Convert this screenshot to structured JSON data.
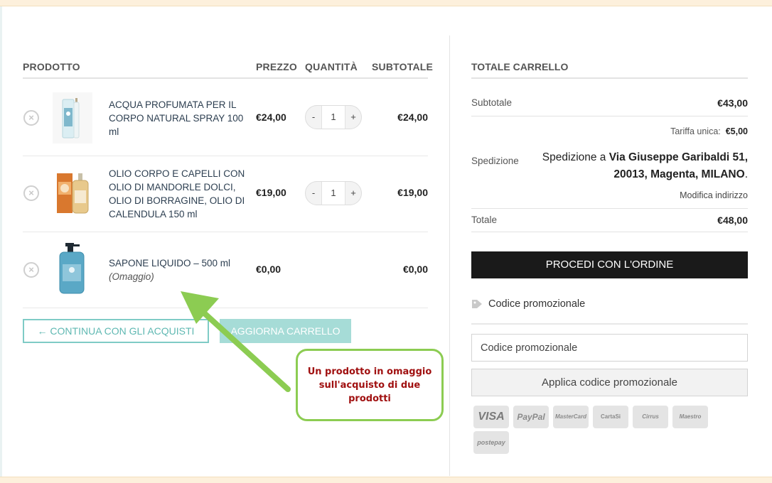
{
  "cart": {
    "headers": {
      "product": "PRODOTTO",
      "price": "PREZZO",
      "quantity": "QUANTITÀ",
      "subtotal": "SUBTOTALE"
    },
    "items": [
      {
        "name": "ACQUA PROFUMATA PER IL CORPO NATURAL SPRAY 100 ml",
        "note": "",
        "price": "€24,00",
        "quantity": "1",
        "subtotal": "€24,00",
        "image": "spray-bottle"
      },
      {
        "name": "OLIO CORPO E CAPELLI CON OLIO DI MANDORLE DOLCI, OLIO DI BORRAGINE, OLIO DI CALENDULA 150 ml",
        "note": "",
        "price": "€19,00",
        "quantity": "1",
        "subtotal": "€19,00",
        "image": "oil-bottle-box"
      },
      {
        "name": "SAPONE LIQUIDO – 500 ml",
        "note": "(Omaggio)",
        "price": "€0,00",
        "quantity": "",
        "subtotal": "€0,00",
        "image": "soap-pump"
      }
    ],
    "qty_minus": "-",
    "qty_plus": "+",
    "remove_symbol": "×",
    "continue_label": "← CONTINUA CON GLI ACQUISTI",
    "update_label": "AGGIORNA CARRELLO"
  },
  "totals": {
    "title": "TOTALE CARRELLO",
    "subtotal_label": "Subtotale",
    "subtotal_value": "€43,00",
    "shipping_label": "Spedizione",
    "shipping_rate_label": "Tariffa unica:",
    "shipping_rate_value": "€5,00",
    "shipping_prefix": "Spedizione a",
    "shipping_address": "Via Giuseppe Garibaldi 51, 20013, Magenta, MILANO",
    "shipping_suffix": ".",
    "modify_address": "Modifica indirizzo",
    "total_label": "Totale",
    "total_value": "€48,00",
    "order_button": "PROCEDI CON L'ORDINE"
  },
  "promo": {
    "label": "Codice promozionale",
    "placeholder": "Codice promozionale",
    "apply_button": "Applica codice promozionale"
  },
  "payments": [
    "VISA",
    "PayPal",
    "MasterCard",
    "CartaSi",
    "Cirrus",
    "Maestro",
    "postepay"
  ],
  "annotation": {
    "text": "Un prodotto in omaggio sull'acquisto di due prodotti",
    "border_color": "#8ccc52",
    "text_color": "#a01010"
  },
  "colors": {
    "accent_teal": "#7fcbc6",
    "order_button": "#1a1a1a"
  }
}
